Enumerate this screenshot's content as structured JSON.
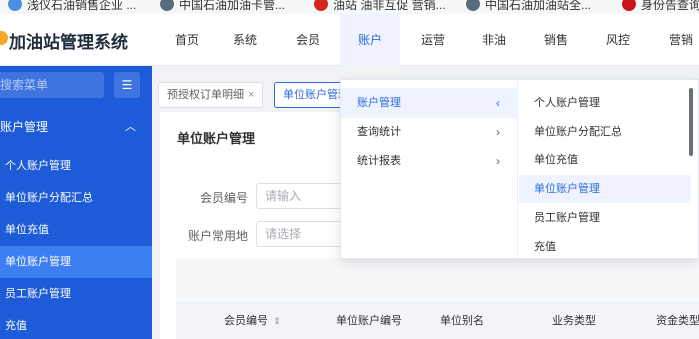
{
  "bookmarks": [
    {
      "label": "浅仪石油销售企业 ...",
      "icon": "orbit-icon",
      "color": "#4a90e2"
    },
    {
      "label": "中国石油加油卡管...",
      "icon": "globe-icon",
      "color": "#5a6b7c"
    },
    {
      "label": "油站 油非互促 营销...",
      "icon": "sale-badge-icon",
      "color": "#d4281c"
    },
    {
      "label": "中国石油加油站全...",
      "icon": "globe-icon",
      "color": "#5a6b7c"
    },
    {
      "label": "身份告查询",
      "icon": "emblem-icon",
      "color": "#c8161d"
    }
  ],
  "app": {
    "title": "加油站管理系统"
  },
  "nav": [
    "首页",
    "系统",
    "会员",
    "账户",
    "运营",
    "非油",
    "销售",
    "风控",
    "营销"
  ],
  "nav_active_index": 3,
  "sidebar": {
    "search_placeholder": "搜索菜单",
    "collapse_icon": "collapse-icon",
    "group": "账户管理",
    "items": [
      "个人账户管理",
      "单位账户分配汇总",
      "单位充值",
      "单位账户管理",
      "员工账户管理",
      "充值"
    ],
    "active_index": 3
  },
  "tabs": [
    {
      "label": "预授权订单明细",
      "close": "×"
    },
    {
      "label": "单位账户管理"
    }
  ],
  "content": {
    "title": "单位账户管理",
    "fields": [
      {
        "label": "会员编号",
        "placeholder": "请输入"
      },
      {
        "label": "账户常用地",
        "placeholder": "请选择"
      }
    ],
    "table_headers": [
      "会员编号",
      "单位账户编号",
      "单位别名",
      "业务类型",
      "资金类型"
    ],
    "sort_icon": "sort-icon"
  },
  "dropdown": {
    "left": [
      {
        "label": "账户管理",
        "arrow": "‹"
      },
      {
        "label": "查询统计",
        "arrow": "›"
      },
      {
        "label": "统计报表",
        "arrow": "›"
      }
    ],
    "left_active_index": 0,
    "right": [
      "个人账户管理",
      "单位账户分配汇总",
      "单位充值",
      "单位账户管理",
      "员工账户管理",
      "充值"
    ],
    "right_active_index": 3
  },
  "colors": {
    "primary": "#2f6bdc",
    "sidebar": "#1d5bd8",
    "sidebar_active": "#3d7ff0"
  }
}
